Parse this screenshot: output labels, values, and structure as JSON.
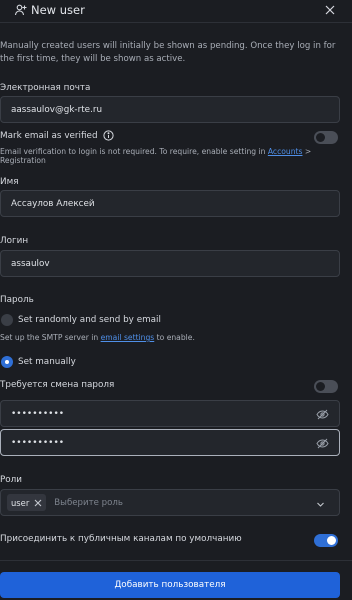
{
  "header": {
    "title": "New user"
  },
  "intro": "Manually created users will initially be shown as pending. Once they log in for the first time, they will be shown as active.",
  "email": {
    "label": "Электронная почта",
    "value": "aassaulov@gk-rte.ru",
    "verified_label": "Mark email as verified",
    "verified_on": false,
    "hint_prefix": "Email verification to login is not required. To require, enable setting in ",
    "hint_link": "Accounts",
    "hint_suffix": " > Registration"
  },
  "name": {
    "label": "Имя",
    "value": "Ассаулов Алексей"
  },
  "login": {
    "label": "Логин",
    "value": "assaulov"
  },
  "password": {
    "label": "Пароль",
    "random_label": "Set randomly and send by email",
    "random_hint_prefix": "Set up the SMTP server in ",
    "random_hint_link": "email settings",
    "random_hint_suffix": " to enable.",
    "manual_label": "Set manually",
    "selected": "manual",
    "change_required_label": "Требуется смена пароля",
    "change_required_on": false,
    "value": "••••••••••",
    "confirm_value": "••••••••••"
  },
  "roles": {
    "label": "Роли",
    "selected": [
      "user"
    ],
    "placeholder": "Выберите роль"
  },
  "join_channels": {
    "label": "Присоединить к публичным каналам по умолчанию",
    "on": true
  },
  "submit_label": "Добавить пользователя",
  "colors": {
    "accent": "#1f62d9",
    "background": "#1b1d22",
    "input_bg": "#23262c",
    "link": "#4f8fe8"
  }
}
